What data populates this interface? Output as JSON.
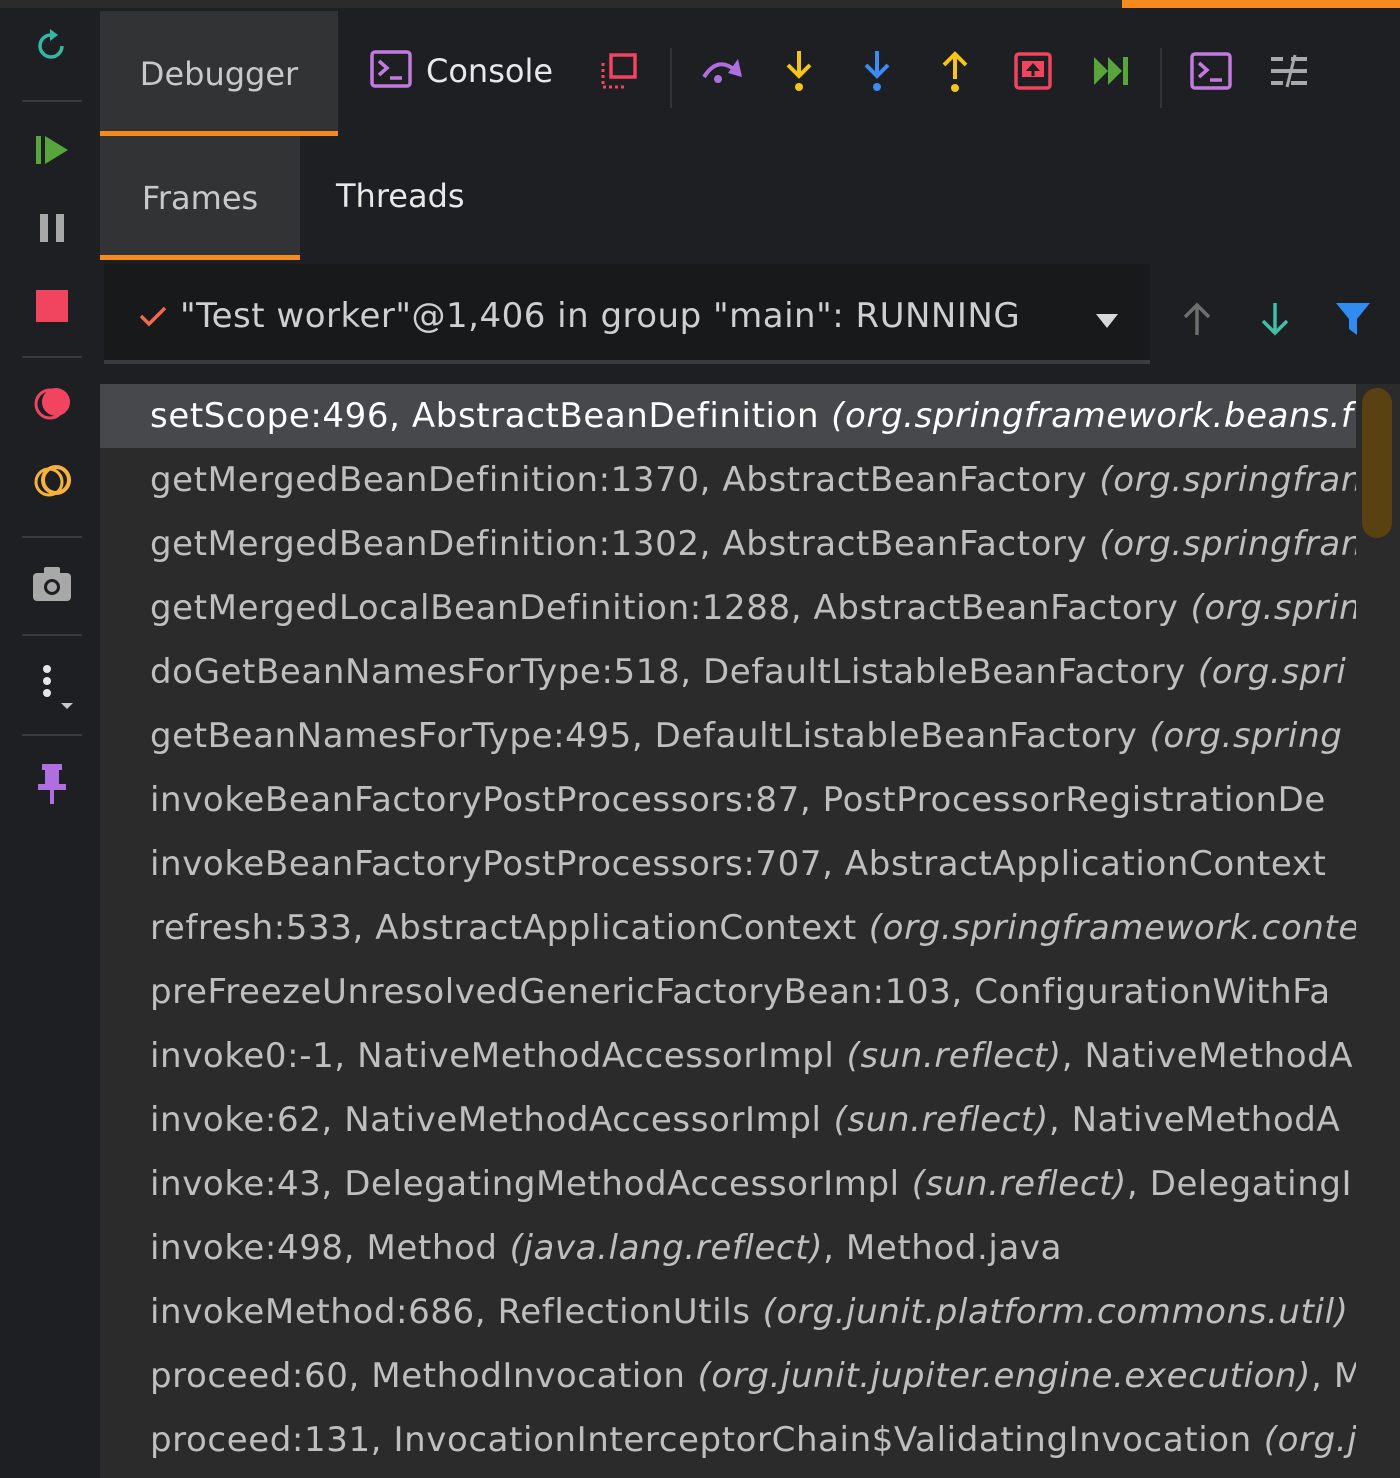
{
  "tabs": {
    "debugger": "Debugger",
    "console": "Console",
    "frames": "Frames",
    "threads": "Threads"
  },
  "thread_selector": {
    "value": "\"Test worker\"@1,406 in group \"main\": RUNNING"
  },
  "left_toolbar_icons": [
    "rerun-icon",
    "resume-icon",
    "pause-icon",
    "stop-icon",
    "view-breakpoints-icon",
    "mute-breakpoints-icon",
    "camera-icon",
    "more-icon",
    "pin-icon"
  ],
  "top_toolbar_icons": [
    "restore-layout-icon",
    "step-over-icon",
    "step-into-icon",
    "force-step-into-icon",
    "step-out-icon",
    "drop-frame-icon",
    "run-to-cursor-icon",
    "evaluate-expression-icon",
    "trace-icon"
  ],
  "colors": {
    "accent": "#f58b1f",
    "selection": "#46484b",
    "background": "#1e1f22",
    "list_background": "#2b2b2b"
  },
  "frames": [
    {
      "method": "setScope:496, AbstractBeanDefinition",
      "pkg": "(org.springframework.beans.f",
      "tail": "",
      "selected": true
    },
    {
      "method": "getMergedBeanDefinition:1370, AbstractBeanFactory",
      "pkg": "(org.springfran",
      "tail": ""
    },
    {
      "method": "getMergedBeanDefinition:1302, AbstractBeanFactory",
      "pkg": "(org.springfran",
      "tail": ""
    },
    {
      "method": "getMergedLocalBeanDefinition:1288, AbstractBeanFactory",
      "pkg": "(org.sprin",
      "tail": ""
    },
    {
      "method": "doGetBeanNamesForType:518, DefaultListableBeanFactory",
      "pkg": "(org.spri",
      "tail": ""
    },
    {
      "method": "getBeanNamesForType:495, DefaultListableBeanFactory",
      "pkg": "(org.spring",
      "tail": ""
    },
    {
      "method": "invokeBeanFactoryPostProcessors:87, PostProcessorRegistrationDe",
      "pkg": "",
      "tail": ""
    },
    {
      "method": "invokeBeanFactoryPostProcessors:707, AbstractApplicationContext",
      "pkg": "",
      "tail": ""
    },
    {
      "method": "refresh:533, AbstractApplicationContext",
      "pkg": "(org.springframework.conte",
      "tail": ""
    },
    {
      "method": "preFreezeUnresolvedGenericFactoryBean:103, ConfigurationWithFa",
      "pkg": "",
      "tail": ""
    },
    {
      "method": "invoke0:-1, NativeMethodAccessorImpl",
      "pkg": "(sun.reflect)",
      "tail": ", NativeMethodA"
    },
    {
      "method": "invoke:62, NativeMethodAccessorImpl",
      "pkg": "(sun.reflect)",
      "tail": ", NativeMethodA"
    },
    {
      "method": "invoke:43, DelegatingMethodAccessorImpl",
      "pkg": "(sun.reflect)",
      "tail": ", DelegatingI"
    },
    {
      "method": "invoke:498, Method",
      "pkg": "(java.lang.reflect)",
      "tail": ", Method.java"
    },
    {
      "method": "invokeMethod:686, ReflectionUtils",
      "pkg": "(org.junit.platform.commons.util)",
      "tail": ""
    },
    {
      "method": "proceed:60, MethodInvocation",
      "pkg": "(org.junit.jupiter.engine.execution)",
      "tail": ", M"
    },
    {
      "method": "proceed:131, InvocationInterceptorChain$ValidatingInvocation",
      "pkg": "(org.j",
      "tail": ""
    }
  ]
}
